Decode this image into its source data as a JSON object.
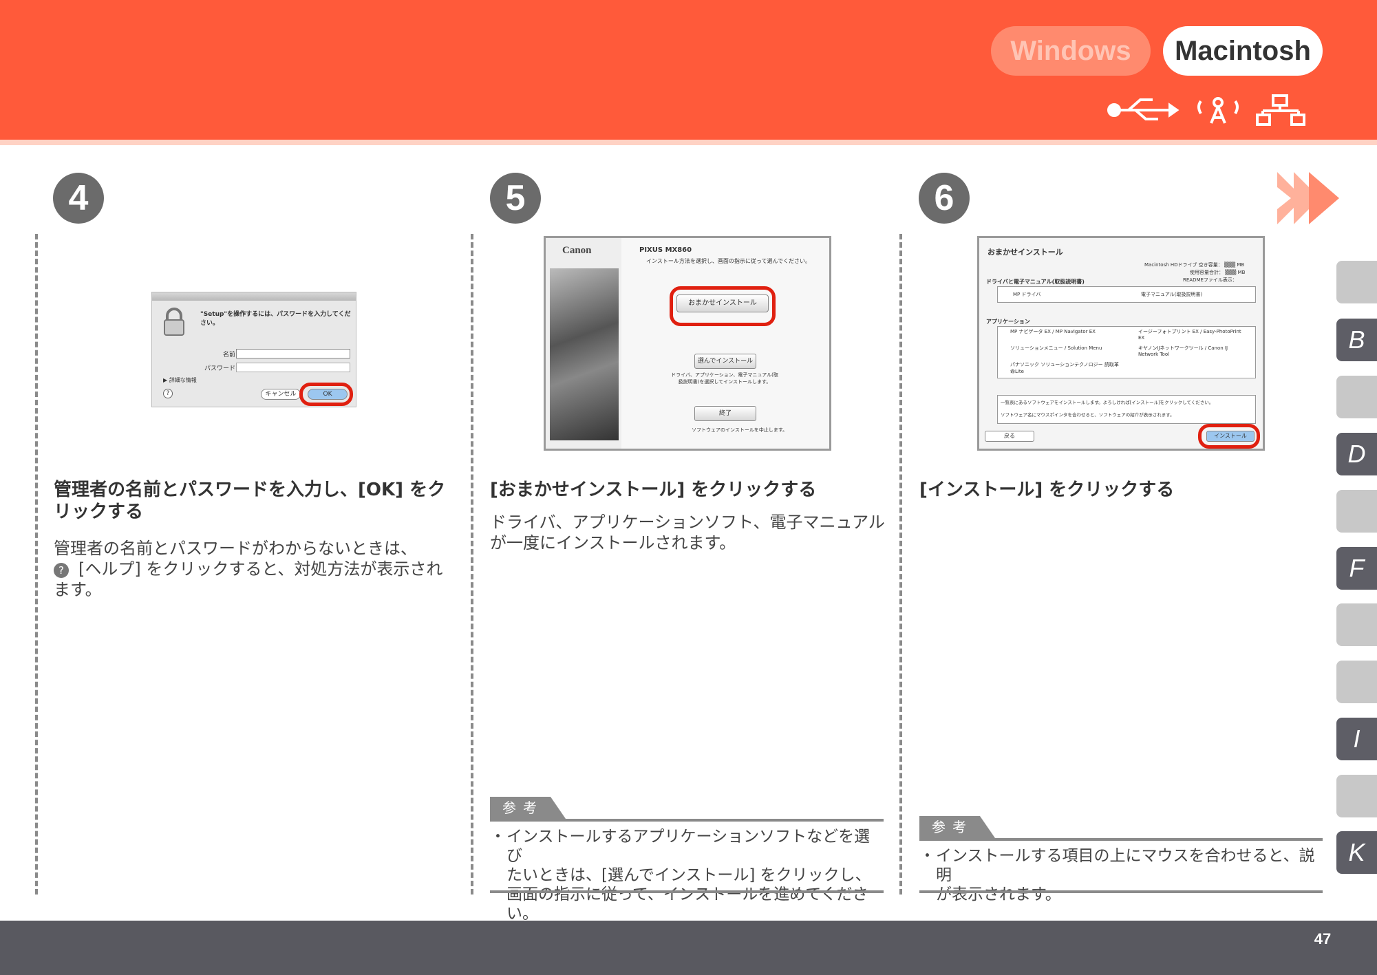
{
  "header": {
    "tabs": [
      {
        "label": "Windows",
        "active": false
      },
      {
        "label": "Macintosh",
        "active": true
      }
    ],
    "connection_icons": [
      "usb-icon",
      "wireless-icon",
      "network-icon"
    ],
    "colors": {
      "header_bg": "#ff5a3a",
      "accent_red": "#e02010"
    }
  },
  "steps": [
    {
      "number": "4",
      "title": "管理者の名前とパスワードを入力し、[OK] をクリックする",
      "body_lines": [
        "管理者の名前とパスワードがわからないときは、",
        "[ヘルプ] をクリックすると、対処方法が表示され",
        "ます。"
      ],
      "screenshot": {
        "prompt": "\"Setup\"を操作するには、パスワードを入力してください。",
        "name_label": "名前：",
        "password_label": "パスワード：",
        "details": "詳細な情報",
        "cancel": "キャンセル",
        "ok": "OK"
      }
    },
    {
      "number": "5",
      "title": "[おまかせインストール] をクリックする",
      "body_lines": [
        "ドライバ、アプリケーションソフト、電子マニュアル",
        "が一度にインストールされます。"
      ],
      "screenshot": {
        "brand": "Canon",
        "model": "PIXUS MX860",
        "instruction": "インストール方法を選択し、画面の指示に従って選んでください。",
        "btn_easy": "おまかせインストール",
        "btn_custom": "選んでインストール",
        "custom_desc": "ドライバ、アプリケーション、電子マニュアル(取扱説明書)を選択してインストールします。",
        "btn_exit": "終了",
        "exit_desc": "ソフトウェアのインストールを中止します。"
      },
      "note": {
        "label": "参考",
        "text_lines": [
          "インストールするアプリケーションソフトなどを選び",
          "たいときは、[選んでインストール] をクリックし、",
          "画面の指示に従って、インストールを進めてください。"
        ]
      }
    },
    {
      "number": "6",
      "title": "[インストール] をクリックする",
      "screenshot": {
        "title": "おまかせインストール",
        "disk_free": "Macintosh HDドライブ 空き容量：",
        "disk_used": "使用容量合計：",
        "readme": "READMEファイル表示：",
        "unit": "MB",
        "section_drivers": "ドライバと電子マニュアル(取扱説明書)",
        "drivers": [
          "MP ドライバ",
          "電子マニュアル(取扱説明書)"
        ],
        "section_apps": "アプリケーション",
        "apps": [
          "MP ナビゲータ EX / MP Navigator EX",
          "イージーフォトプリント EX / Easy-PhotoPrint EX",
          "ソリューションメニュー / Solution Menu",
          "キヤノンIJネットワークツール / Canon IJ Network Tool",
          "パナソニック ソリューションテクノロジー 読取革命Lite"
        ],
        "msg1": "一覧表にあるソフトウェアをインストールします。よろしければ[インストール]をクリックしてください。",
        "msg2": "ソフトウェア名にマウスポインタを合わせると、ソフトウェアの紹介が表示されます。",
        "btn_back": "戻る",
        "btn_install": "インストール"
      },
      "note": {
        "label": "参考",
        "text_lines": [
          "インストールする項目の上にマウスを合わせると、説明",
          "が表示されます。"
        ]
      }
    }
  ],
  "side_tabs": [
    "",
    "B",
    "",
    "D",
    "",
    "F",
    "",
    "",
    "I",
    "",
    "K"
  ],
  "footer": {
    "page": "47"
  }
}
